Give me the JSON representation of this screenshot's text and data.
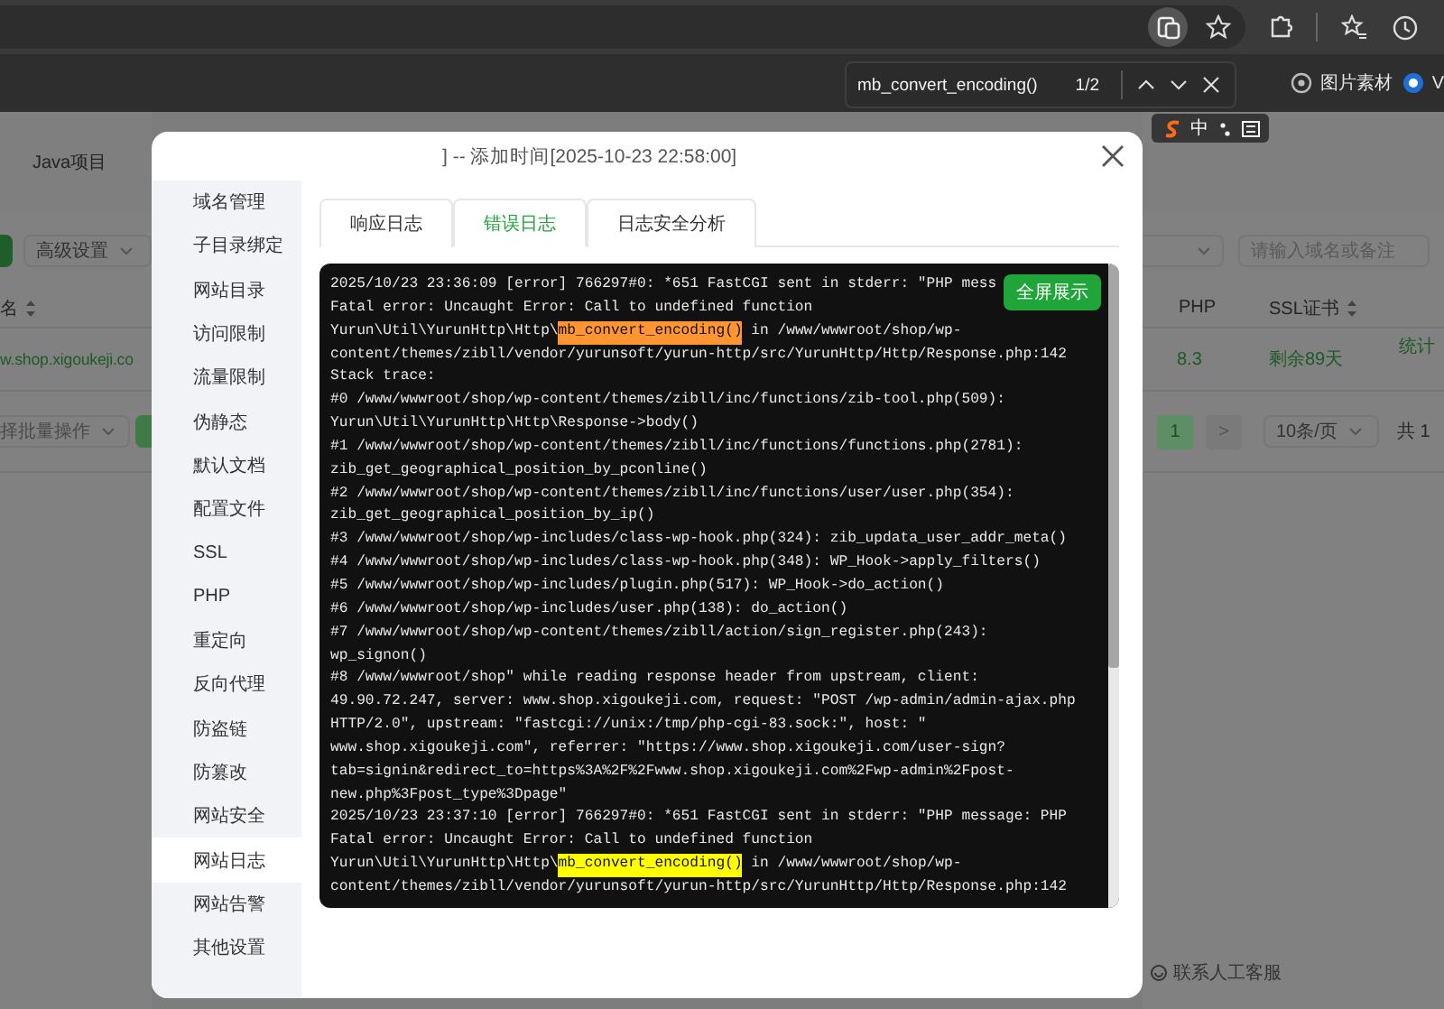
{
  "browser": {
    "bookmarks": [
      {
        "label": "图片素材"
      },
      {
        "label": "V"
      }
    ]
  },
  "find_bar": {
    "query": "mb_convert_encoding()",
    "count": "1/2"
  },
  "ime_bar": {
    "mode": "中"
  },
  "background_page": {
    "nav": [
      "Java项目"
    ],
    "advanced_select": "高级设置",
    "search": {
      "placeholder": "请输入域名或备注"
    },
    "columns": [
      "名",
      "PHP",
      "SSL证书"
    ],
    "row": {
      "site": "w.shop.xigoukeji.co",
      "php": "8.3",
      "ssl": "剩余89天",
      "action": "统计"
    },
    "batch_select": "择批量操作",
    "pagination": {
      "pages": [
        {
          "label": "1",
          "selected": true
        }
      ],
      "next": ">",
      "page_size": "10条/页",
      "total": "共 1"
    },
    "support_link": "联系人工客服"
  },
  "dialog": {
    "title": "] -- 添加时间[2025-10-23 22:58:00]",
    "sidebar": [
      {
        "label": "域名管理",
        "selected": false
      },
      {
        "label": "子目录绑定",
        "selected": false
      },
      {
        "label": "网站目录",
        "selected": false
      },
      {
        "label": "访问限制",
        "selected": false
      },
      {
        "label": "流量限制",
        "selected": false
      },
      {
        "label": "伪静态",
        "selected": false
      },
      {
        "label": "默认文档",
        "selected": false
      },
      {
        "label": "配置文件",
        "selected": false
      },
      {
        "label": "SSL",
        "selected": false
      },
      {
        "label": "PHP",
        "selected": false
      },
      {
        "label": "重定向",
        "selected": false
      },
      {
        "label": "反向代理",
        "selected": false
      },
      {
        "label": "防盗链",
        "selected": false
      },
      {
        "label": "防篡改",
        "selected": false
      },
      {
        "label": "网站安全",
        "selected": false
      },
      {
        "label": "网站日志",
        "selected": true
      },
      {
        "label": "网站告警",
        "selected": false
      },
      {
        "label": "其他设置",
        "selected": false
      }
    ],
    "tabs": [
      {
        "label": "响应日志",
        "selected": false
      },
      {
        "label": "错误日志",
        "selected": true
      },
      {
        "label": "日志安全分析",
        "selected": false
      }
    ],
    "fullscreen_button": "全屏展示",
    "log_lines": [
      {
        "kind": "plain",
        "text": "2025/10/23 23:36:09 [error] 766297#0: *651 FastCGI sent in stderr: \"PHP mess"
      },
      {
        "kind": "plain",
        "text": "Fatal error: Uncaught Error: Call to undefined function"
      },
      {
        "kind": "match",
        "before": "Yurun\\Util\\YurunHttp\\Http\\",
        "match": "mb_convert_encoding()",
        "after": " in /www/wwwroot/shop/wp-",
        "current": true
      },
      {
        "kind": "plain",
        "text": "content/themes/zibll/vendor/yurunsoft/yurun-http/src/YurunHttp/Http/Response.php:142"
      },
      {
        "kind": "plain",
        "text": "Stack trace:"
      },
      {
        "kind": "plain",
        "text": "#0 /www/wwwroot/shop/wp-content/themes/zibll/inc/functions/zib-tool.php(509):"
      },
      {
        "kind": "plain",
        "text": "Yurun\\Util\\YurunHttp\\Http\\Response->body()"
      },
      {
        "kind": "plain",
        "text": "#1 /www/wwwroot/shop/wp-content/themes/zibll/inc/functions/functions.php(2781):"
      },
      {
        "kind": "plain",
        "text": "zib_get_geographical_position_by_pconline()"
      },
      {
        "kind": "plain",
        "text": "#2 /www/wwwroot/shop/wp-content/themes/zibll/inc/functions/user/user.php(354):"
      },
      {
        "kind": "plain",
        "text": "zib_get_geographical_position_by_ip()"
      },
      {
        "kind": "plain",
        "text": "#3 /www/wwwroot/shop/wp-includes/class-wp-hook.php(324): zib_updata_user_addr_meta()"
      },
      {
        "kind": "plain",
        "text": "#4 /www/wwwroot/shop/wp-includes/class-wp-hook.php(348): WP_Hook->apply_filters()"
      },
      {
        "kind": "plain",
        "text": "#5 /www/wwwroot/shop/wp-includes/plugin.php(517): WP_Hook->do_action()"
      },
      {
        "kind": "plain",
        "text": "#6 /www/wwwroot/shop/wp-includes/user.php(138): do_action()"
      },
      {
        "kind": "plain",
        "text": "#7 /www/wwwroot/shop/wp-content/themes/zibll/action/sign_register.php(243):"
      },
      {
        "kind": "plain",
        "text": "wp_signon()"
      },
      {
        "kind": "plain",
        "text": "#8 /www/wwwroot/shop\" while reading response header from upstream, client:"
      },
      {
        "kind": "plain",
        "text": "49.90.72.247, server: www.shop.xigoukeji.com, request: \"POST /wp-admin/admin-ajax.php"
      },
      {
        "kind": "plain",
        "text": "HTTP/2.0\", upstream: \"fastcgi://unix:/tmp/php-cgi-83.sock:\", host: \""
      },
      {
        "kind": "plain",
        "text": "www.shop.xigoukeji.com\", referrer: \"https://www.shop.xigoukeji.com/user-sign?"
      },
      {
        "kind": "plain",
        "text": "tab=signin&redirect_to=https%3A%2F%2Fwww.shop.xigoukeji.com%2Fwp-admin%2Fpost-"
      },
      {
        "kind": "plain",
        "text": "new.php%3Fpost_type%3Dpage\""
      },
      {
        "kind": "plain",
        "text": "2025/10/23 23:37:10 [error] 766297#0: *651 FastCGI sent in stderr: \"PHP message: PHP"
      },
      {
        "kind": "plain",
        "text": "Fatal error: Uncaught Error: Call to undefined function"
      },
      {
        "kind": "match",
        "before": "Yurun\\Util\\YurunHttp\\Http\\",
        "match": "mb_convert_encoding()",
        "after": " in /www/wwwroot/shop/wp-",
        "current": false
      },
      {
        "kind": "plain",
        "text": "content/themes/zibll/vendor/yurunsoft/yurun-http/src/YurunHttp/Http/Response.php:142"
      }
    ]
  }
}
